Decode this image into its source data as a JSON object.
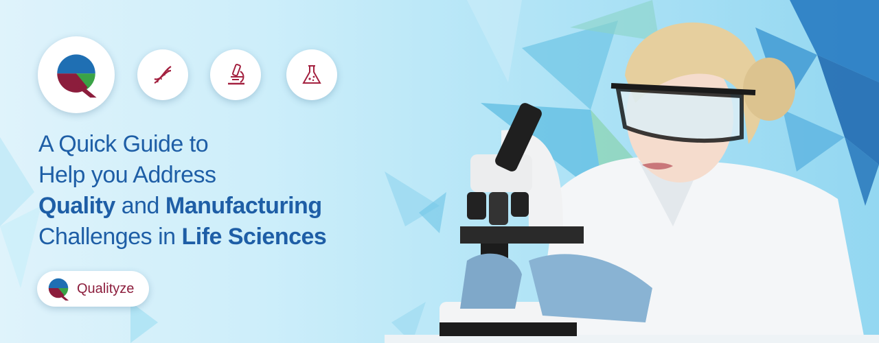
{
  "icons": {
    "logo": "qualityze-logo-icon",
    "dna": "dna-helix-icon",
    "microscope": "microscope-icon",
    "flask": "flask-icon"
  },
  "headline": {
    "line1": "A Quick Guide to",
    "line2": "Help you Address",
    "line3_bold_a": "Quality",
    "line3_mid": " and ",
    "line3_bold_b": "Manufacturing",
    "line4_a": "Challenges in ",
    "line4_bold": "Life Sciences"
  },
  "brand": {
    "name": "Qualityze"
  },
  "colors": {
    "text_blue": "#1e5ea6",
    "brand_maroon": "#8c1d3c",
    "brand_blue": "#1f6fb3",
    "brand_green": "#3aa346"
  }
}
